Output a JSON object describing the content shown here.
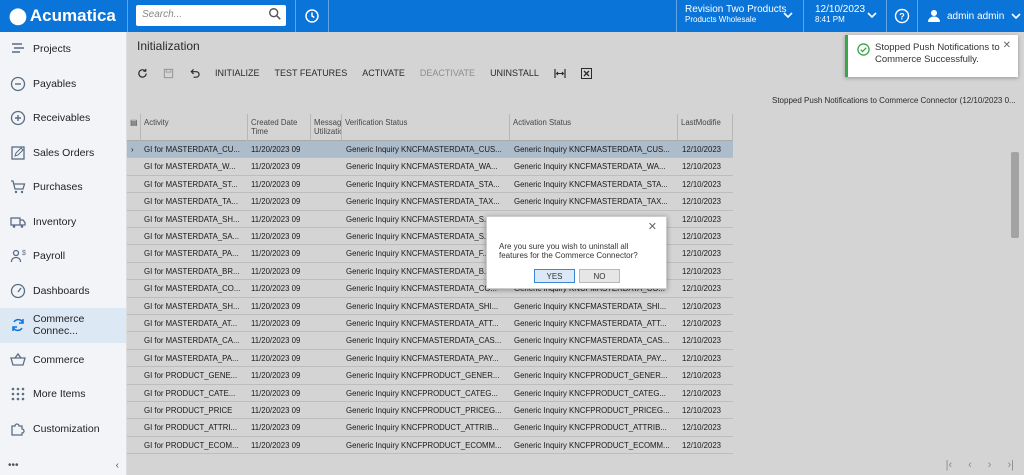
{
  "header": {
    "logo": "Acumatica",
    "search_placeholder": "Search...",
    "company_line1": "Revision Two Products",
    "company_line2": "Products Wholesale",
    "date": "12/10/2023",
    "time": "8:41 PM",
    "user": "admin admin"
  },
  "sidebar": {
    "items": [
      {
        "label": "Projects",
        "icon": "projects-icon"
      },
      {
        "label": "Payables",
        "icon": "minus-circle-icon"
      },
      {
        "label": "Receivables",
        "icon": "plus-circle-icon"
      },
      {
        "label": "Sales Orders",
        "icon": "edit-icon"
      },
      {
        "label": "Purchases",
        "icon": "cart-icon"
      },
      {
        "label": "Inventory",
        "icon": "truck-icon"
      },
      {
        "label": "Payroll",
        "icon": "payroll-icon"
      },
      {
        "label": "Dashboards",
        "icon": "gauge-icon"
      },
      {
        "label": "Commerce Connec...",
        "icon": "sync-icon"
      },
      {
        "label": "Commerce",
        "icon": "basket-icon"
      },
      {
        "label": "More Items",
        "icon": "grid-dots-icon"
      },
      {
        "label": "Customization",
        "icon": "puzzle-icon"
      }
    ],
    "active_index": 8
  },
  "page": {
    "title": "Initialization",
    "toolbar": {
      "initialize": "INITIALIZE",
      "test_features": "TEST FEATURES",
      "activate": "ACTIVATE",
      "deactivate": "DEACTIVATE",
      "uninstall": "UNINSTALL"
    },
    "status_line": "Stopped Push Notifications to Commerce Connector (12/10/2023 0..."
  },
  "grid": {
    "columns": [
      "Activity",
      "Created Date Time",
      "Message Utilization",
      "Verification Status",
      "Activation Status",
      "LastModifie"
    ],
    "rows": [
      [
        "GI for MASTERDATA_CU...",
        "11/20/2023 09",
        "",
        "Generic Inquiry KNCFMASTERDATA_CUS...",
        "Generic Inquiry KNCFMASTERDATA_CUS...",
        "12/10/2023"
      ],
      [
        "GI for MASTERDATA_W...",
        "11/20/2023 09",
        "",
        "Generic Inquiry KNCFMASTERDATA_WA...",
        "Generic Inquiry KNCFMASTERDATA_WA...",
        "12/10/2023"
      ],
      [
        "GI for MASTERDATA_ST...",
        "11/20/2023 09",
        "",
        "Generic Inquiry KNCFMASTERDATA_STA...",
        "Generic Inquiry KNCFMASTERDATA_STA...",
        "12/10/2023"
      ],
      [
        "GI for MASTERDATA_TA...",
        "11/20/2023 09",
        "",
        "Generic Inquiry KNCFMASTERDATA_TAX...",
        "Generic Inquiry KNCFMASTERDATA_TAX...",
        "12/10/2023"
      ],
      [
        "GI for MASTERDATA_SH...",
        "11/20/2023 09",
        "",
        "Generic Inquiry KNCFMASTERDATA_S...",
        "Generic Inquiry KNCFMASTERDATA_SH...",
        "12/10/2023"
      ],
      [
        "GI for MASTERDATA_SA...",
        "11/20/2023 09",
        "",
        "Generic Inquiry KNCFMASTERDATA_S...",
        "Generic Inquiry KNCFMASTERDATA_SA...",
        "12/10/2023"
      ],
      [
        "GI for MASTERDATA_PA...",
        "11/20/2023 09",
        "",
        "Generic Inquiry KNCFMASTERDATA_F...",
        "Generic Inquiry KNCFMASTERDATA_PA...",
        "12/10/2023"
      ],
      [
        "GI for MASTERDATA_BR...",
        "11/20/2023 09",
        "",
        "Generic Inquiry KNCFMASTERDATA_B...",
        "Generic Inquiry KNCFMASTERDATA_BR...",
        "12/10/2023"
      ],
      [
        "GI for MASTERDATA_CO...",
        "11/20/2023 09",
        "",
        "Generic Inquiry KNCFMASTERDATA_CO...",
        "Generic Inquiry KNCFMASTERDATA_CO...",
        "12/10/2023"
      ],
      [
        "GI for MASTERDATA_SH...",
        "11/20/2023 09",
        "",
        "Generic Inquiry KNCFMASTERDATA_SHI...",
        "Generic Inquiry KNCFMASTERDATA_SHI...",
        "12/10/2023"
      ],
      [
        "GI for MASTERDATA_AT...",
        "11/20/2023 09",
        "",
        "Generic Inquiry KNCFMASTERDATA_ATT...",
        "Generic Inquiry KNCFMASTERDATA_ATT...",
        "12/10/2023"
      ],
      [
        "GI for MASTERDATA_CA...",
        "11/20/2023 09",
        "",
        "Generic Inquiry KNCFMASTERDATA_CAS...",
        "Generic Inquiry KNCFMASTERDATA_CAS...",
        "12/10/2023"
      ],
      [
        "GI for MASTERDATA_PA...",
        "11/20/2023 09",
        "",
        "Generic Inquiry KNCFMASTERDATA_PAY...",
        "Generic Inquiry KNCFMASTERDATA_PAY...",
        "12/10/2023"
      ],
      [
        "GI for PRODUCT_GENE...",
        "11/20/2023 09",
        "",
        "Generic Inquiry KNCFPRODUCT_GENER...",
        "Generic Inquiry KNCFPRODUCT_GENER...",
        "12/10/2023"
      ],
      [
        "GI for PRODUCT_CATE...",
        "11/20/2023 09",
        "",
        "Generic Inquiry KNCFPRODUCT_CATEG...",
        "Generic Inquiry KNCFPRODUCT_CATEG...",
        "12/10/2023"
      ],
      [
        "GI for PRODUCT_PRICE",
        "11/20/2023 09",
        "",
        "Generic Inquiry KNCFPRODUCT_PRICEG...",
        "Generic Inquiry KNCFPRODUCT_PRICEG...",
        "12/10/2023"
      ],
      [
        "GI for PRODUCT_ATTRI...",
        "11/20/2023 09",
        "",
        "Generic Inquiry KNCFPRODUCT_ATTRIB...",
        "Generic Inquiry KNCFPRODUCT_ATTRIB...",
        "12/10/2023"
      ],
      [
        "GI for PRODUCT_ECOM...",
        "11/20/2023 09",
        "",
        "Generic Inquiry KNCFPRODUCT_ECOMM...",
        "Generic Inquiry KNCFPRODUCT_ECOMM...",
        "12/10/2023"
      ]
    ]
  },
  "toast": {
    "message": "Stopped Push Notifications to Commerce Successfully.",
    "close": "✕"
  },
  "dialog": {
    "message": "Are you sure you wish to uninstall all features for the Commerce Connector?",
    "yes": "YES",
    "no": "NO",
    "close": "✕"
  },
  "colors": {
    "brand": "#0a74d9",
    "success": "#3aa64b",
    "selected_row": "#cfe2f5"
  }
}
